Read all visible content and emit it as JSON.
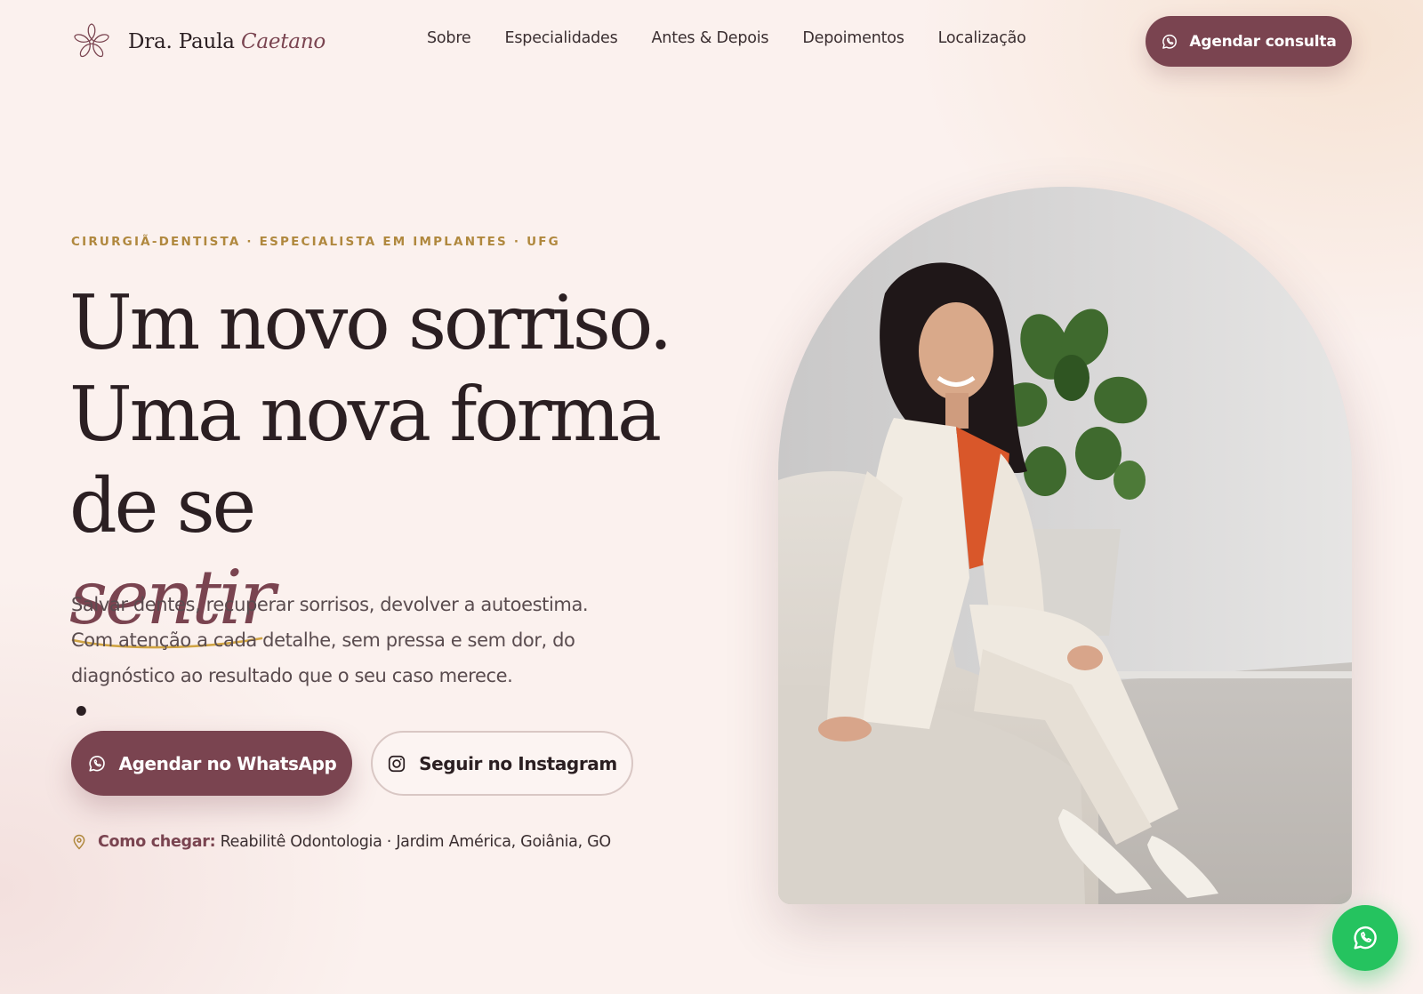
{
  "brand": {
    "name_first": "Dra. Paula",
    "name_accent": "Caetano",
    "icon": "flower-logo-icon"
  },
  "nav": {
    "items": [
      {
        "label": "Sobre"
      },
      {
        "label": "Especialidades"
      },
      {
        "label": "Antes & Depois"
      },
      {
        "label": "Depoimentos"
      },
      {
        "label": "Localização"
      }
    ]
  },
  "header_cta": {
    "label": "Agendar consulta",
    "icon": "whatsapp-icon"
  },
  "hero": {
    "eyebrow": "CIRURGIÃ-DENTISTA · ESPECIALISTA EM IMPLANTES · UFG",
    "headline_line1": "Um novo sorriso.",
    "headline_line2": "Uma nova forma",
    "headline_line3_pre": "de se ",
    "headline_line3_em": "sentir",
    "headline_line3_post": ".",
    "lede": "Salvar dentes, recuperar sorrisos, devolver a autoestima. Com atenção a cada detalhe, sem pressa e sem dor, do diagnóstico ao resultado que o seu caso merece.",
    "primary_cta": {
      "label": "Agendar no WhatsApp",
      "icon": "whatsapp-icon"
    },
    "secondary_cta": {
      "label": "Seguir no Instagram",
      "icon": "instagram-icon"
    },
    "location": {
      "icon": "map-pin-icon",
      "label": "Como chegar:",
      "text": "Reabilitê Odontologia · Jardim América, Goiânia, GO"
    }
  },
  "portrait": {
    "icon": "dentist-portrait-photo"
  },
  "floating_button": {
    "icon": "whatsapp-icon"
  },
  "colors": {
    "accent": "#7a4450",
    "gold": "#b0883e",
    "background": "#fbf1ee",
    "whatsapp_green": "#25c35f"
  }
}
